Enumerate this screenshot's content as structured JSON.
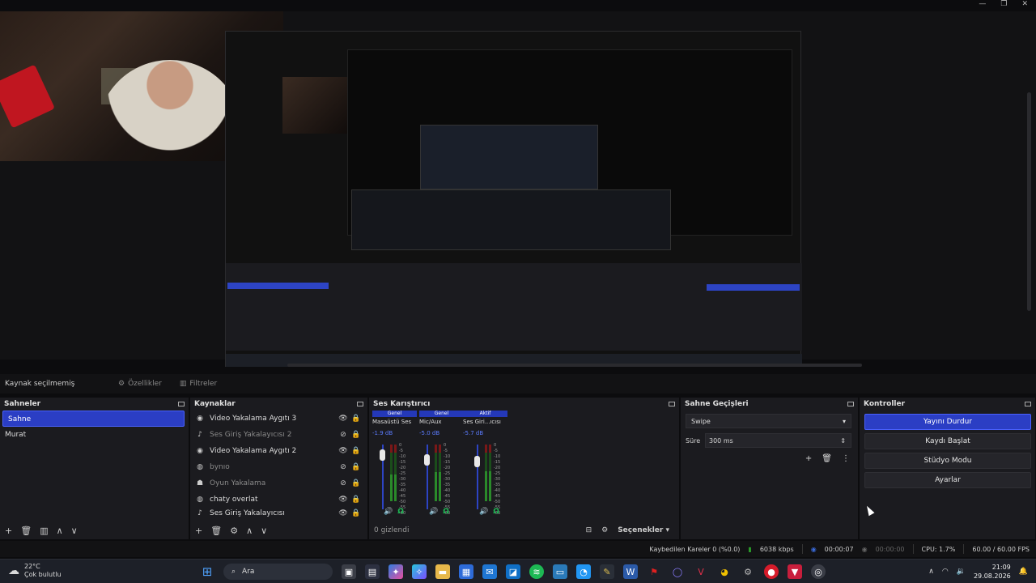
{
  "window": {
    "controls": [
      "—",
      "❐",
      "✕"
    ]
  },
  "toolbar": {
    "source_status": "Kaynak seçilmemiş",
    "properties": "Özellikler",
    "filters": "Filtreler"
  },
  "scenes": {
    "title": "Sahneler",
    "items": [
      {
        "label": "Sahne",
        "selected": true
      },
      {
        "label": "Murat",
        "selected": false
      }
    ]
  },
  "sources": {
    "title": "Kaynaklar",
    "items": [
      {
        "label": "Video Yakalama Aygıtı 3",
        "icon": "camera-icon",
        "visible": true
      },
      {
        "label": "Ses Giriş Yakalayıcısı 2",
        "icon": "mic-icon",
        "visible": false
      },
      {
        "label": "Video Yakalama Aygıtı 2",
        "icon": "camera-icon",
        "visible": true
      },
      {
        "label": "bynıo",
        "icon": "browser-icon",
        "visible": false
      },
      {
        "label": "Oyun Yakalama",
        "icon": "gamepad-icon",
        "visible": false
      },
      {
        "label": "chaty overlat",
        "icon": "browser-icon",
        "visible": true
      },
      {
        "label": "Ses Giriş Yakalayıcısı",
        "icon": "mic-icon",
        "visible": true
      }
    ]
  },
  "mixer": {
    "title": "Ses Karıştırıcı",
    "hidden_count": "0 gizlendi",
    "options_label": "Seçenekler",
    "channels": [
      {
        "tab": "Genel",
        "name": "Masaüstü Ses",
        "db": "-1.9 dB",
        "level": 0.55
      },
      {
        "tab": "Genel",
        "name": "Mic/Aux",
        "db": "-5.0 dB",
        "level": 0.6
      },
      {
        "tab": "Aktif",
        "name": "Ses Giriş Yakalayıcısı",
        "name_short": "Ses Giri...ıcısı",
        "db": "-5.7 dB",
        "level": 0.62
      }
    ],
    "scale": [
      "0",
      "-5",
      "-10",
      "-15",
      "-20",
      "-25",
      "-30",
      "-35",
      "-40",
      "-45",
      "-50",
      "-55",
      "-60"
    ]
  },
  "transitions": {
    "title": "Sahne Geçişleri",
    "selected": "Swipe",
    "duration_label": "Süre",
    "duration_value": "300 ms"
  },
  "controls": {
    "title": "Kontroller",
    "buttons": [
      "Yayını Durdur",
      "Kaydı Başlat",
      "Stüdyo Modu",
      "Ayarlar"
    ]
  },
  "status": {
    "dropped": "Kaybedilen Kareler 0 (%0.0)",
    "bitrate": "6038 kbps",
    "stream_time": "00:00:07",
    "rec_time": "00:00:00",
    "cpu": "CPU: 1.7%",
    "fps": "60.00 / 60.00 FPS"
  },
  "taskbar": {
    "temp": "22°C",
    "weather": "Çok bulutlu",
    "search": "Ara",
    "time": "21:09",
    "date": "29.08.2026"
  },
  "colors": {
    "accent": "#2b3ec4",
    "bg": "#1b1b1f",
    "meter_green": "#2a8a2a"
  }
}
